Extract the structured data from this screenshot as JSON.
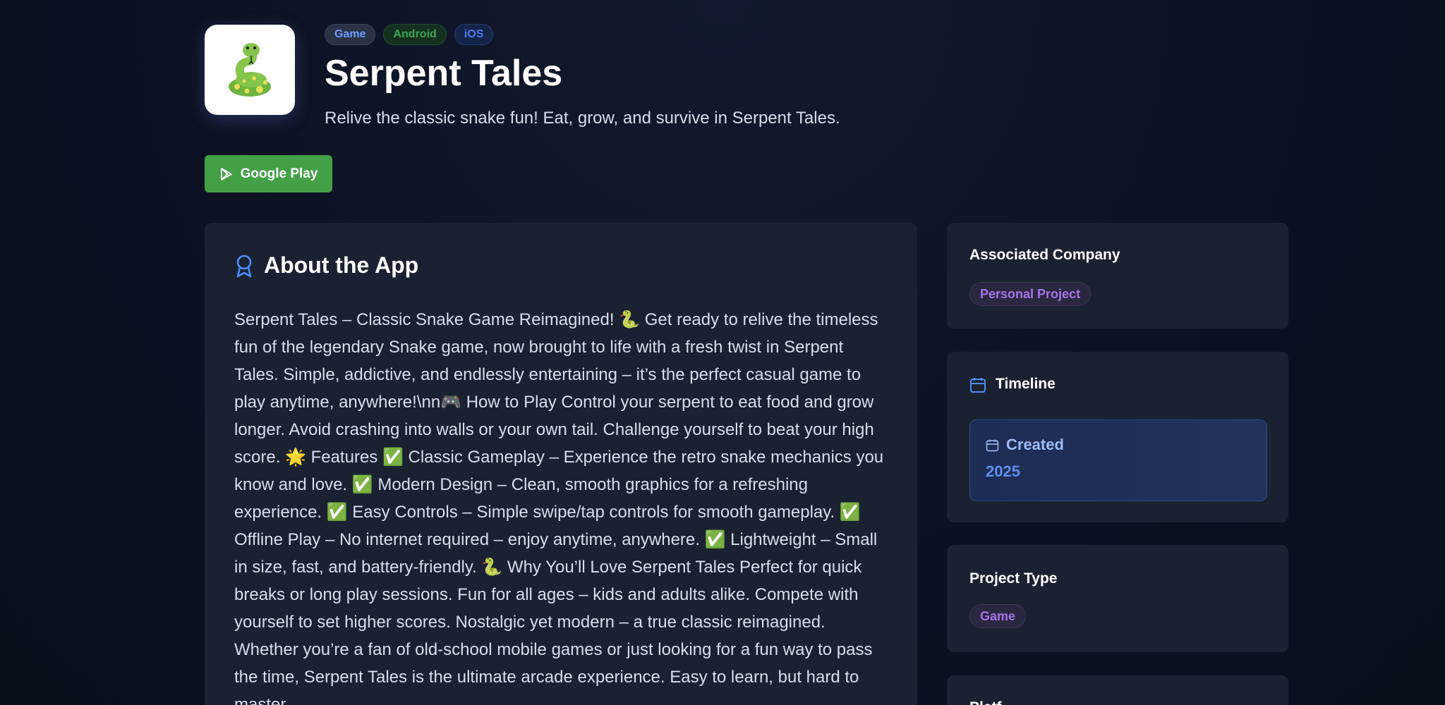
{
  "header": {
    "tags": [
      "Game",
      "Android",
      "iOS"
    ],
    "title": "Serpent Tales",
    "subtitle": "Relive the classic snake fun! Eat, grow, and survive in Serpent Tales.",
    "app_icon": "snake-emoji",
    "store_button_label": "Google Play",
    "store_button_icon": "play-store-icon"
  },
  "about": {
    "title": "About the App",
    "icon": "award-icon",
    "description": "Serpent Tales – Classic Snake Game Reimagined! 🐍 Get ready to relive the timeless fun of the legendary Snake game, now brought to life with a fresh twist in Serpent Tales. Simple, addictive, and endlessly entertaining – it’s the perfect casual game to play anytime, anywhere!\\nn🎮 How to Play Control your serpent to eat food and grow longer. Avoid crashing into walls or your own tail. Challenge yourself to beat your high score. 🌟 Features ✅ Classic Gameplay – Experience the retro snake mechanics you know and love. ✅ Modern Design – Clean, smooth graphics for a refreshing experience. ✅ Easy Controls – Simple swipe/tap controls for smooth gameplay. ✅ Offline Play – No internet required – enjoy anytime, anywhere. ✅ Lightweight – Small in size, fast, and battery-friendly. 🐍 Why You’ll Love Serpent Tales Perfect for quick breaks or long play sessions. Fun for all ages – kids and adults alike. Compete with yourself to set higher scores. Nostalgic yet modern – a true classic reimagined. Whether you’re a fan of old-school mobile games or just looking for a fun way to pass the time, Serpent Tales is the ultimate arcade experience. Easy to learn, but hard to master"
  },
  "sidebar": {
    "company": {
      "title": "Associated Company",
      "value": "Personal Project"
    },
    "timeline": {
      "title": "Timeline",
      "icon": "calendar-icon",
      "created_label": "Created",
      "created_year": "2025"
    },
    "project_type": {
      "title": "Project Type",
      "value": "Game"
    },
    "platforms": {
      "title": "Platf"
    }
  },
  "colors": {
    "background": "#0b1120",
    "card": "#1a2232",
    "accent_green": "#43a047",
    "accent_blue": "#4c7cf0",
    "accent_purple": "#a874e8"
  }
}
